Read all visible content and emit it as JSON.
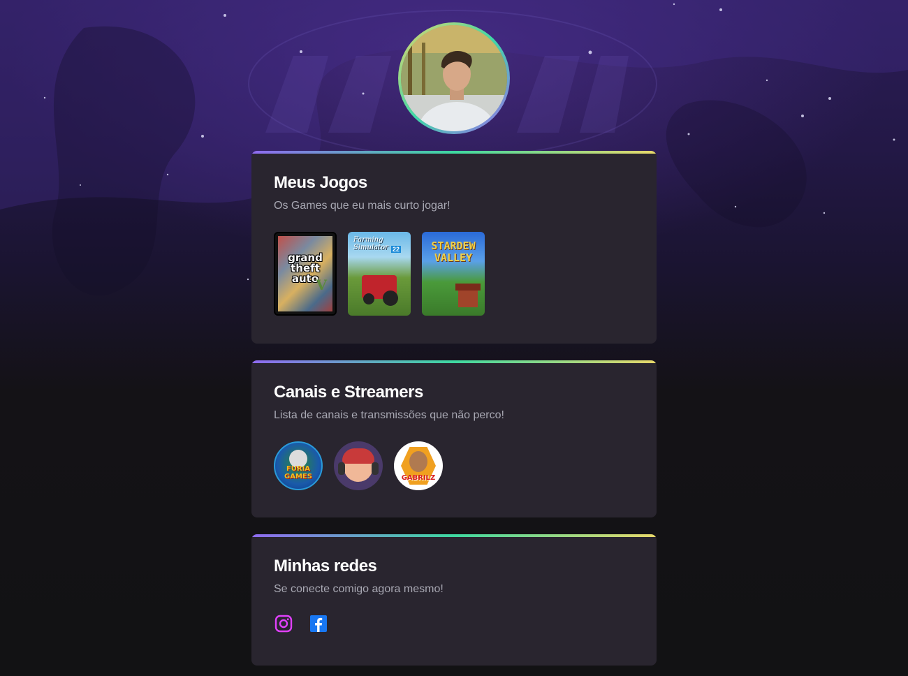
{
  "colors": {
    "accent_gradient": [
      "#8f6af0",
      "#3ed8a0",
      "#e8d86a"
    ],
    "card_bg": "#29252f",
    "title": "#ffffff",
    "subtitle": "#a8a8b3",
    "instagram": "#e040fb",
    "facebook": "#1877f2"
  },
  "profile": {
    "avatar_icon": "profile-photo"
  },
  "games": {
    "title": "Meus Jogos",
    "subtitle": "Os Games que eu mais curto jogar!",
    "items": [
      {
        "name": "grand theft auto V",
        "line1": "grand",
        "line2": "theft",
        "line3": "auto",
        "badge": "V"
      },
      {
        "name": "Farming Simulator 22",
        "line1": "Farming",
        "line2": "Simulator",
        "badge": "22"
      },
      {
        "name": "STARDEW VALLEY",
        "line1": "STARDEW",
        "line2": "VALLEY"
      }
    ]
  },
  "streamers": {
    "title": "Canais e Streamers",
    "subtitle": "Lista de canais e transmissões que não perco!",
    "items": [
      {
        "name": "FURIA GAMES",
        "label": "FURIA GAMES"
      },
      {
        "name": "streamer-cartoon",
        "label": ""
      },
      {
        "name": "GABRILZ",
        "label": "GABRILZ"
      }
    ]
  },
  "socials": {
    "title": "Minhas redes",
    "subtitle": "Se conecte comigo agora mesmo!",
    "items": [
      {
        "name": "instagram",
        "icon": "instagram-icon"
      },
      {
        "name": "facebook",
        "icon": "facebook-icon"
      }
    ]
  }
}
